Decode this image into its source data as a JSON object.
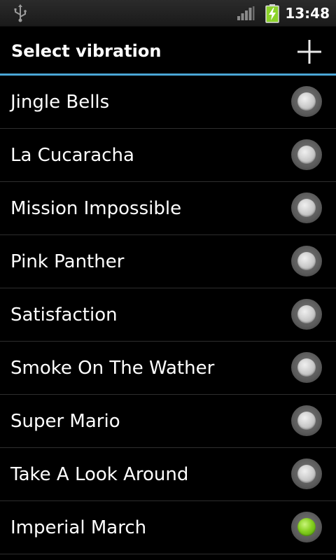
{
  "status_bar": {
    "time": "13:48",
    "icons": [
      "usb-icon",
      "signal-icon",
      "battery-charging-icon"
    ]
  },
  "header": {
    "title": "Select vibration",
    "add_icon": "plus-icon"
  },
  "colors": {
    "accent_divider": "#4aa6d6",
    "selected_radio": "#7cc71a",
    "battery_green": "#8cd32a"
  },
  "list": {
    "items": [
      {
        "label": "Jingle Bells",
        "selected": false
      },
      {
        "label": "La Cucaracha",
        "selected": false
      },
      {
        "label": "Mission Impossible",
        "selected": false
      },
      {
        "label": "Pink Panther",
        "selected": false
      },
      {
        "label": "Satisfaction",
        "selected": false
      },
      {
        "label": "Smoke On The Wather",
        "selected": false
      },
      {
        "label": "Super Mario",
        "selected": false
      },
      {
        "label": "Take A Look Around",
        "selected": false
      },
      {
        "label": "Imperial March",
        "selected": true
      }
    ]
  }
}
